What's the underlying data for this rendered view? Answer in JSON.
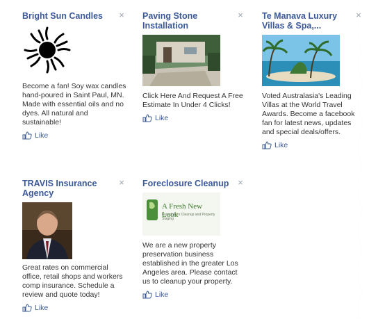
{
  "ads": [
    {
      "title": "Bright Sun Candles",
      "close": "×",
      "body": "Become a fan! Soy wax candles hand-poured in Saint Paul, MN. Made with essential oils and no dyes. All natural and sustainable!",
      "like": "Like",
      "image": "black-sun-icon"
    },
    {
      "title": "Paving Stone Installation",
      "close": "×",
      "body": "Click Here And Request A Free Estimate In Under 4 Clicks!",
      "like": "Like",
      "image": "paving-patio-photo"
    },
    {
      "title": "Te Manava Luxury Villas & Spa,...",
      "close": "×",
      "body": "Voted Australasia's Leading Villas at the World Travel Awards. Become a facebook fan for latest news, updates and special deals/offers.",
      "like": "Like",
      "image": "tropical-beach-photo"
    },
    {
      "title": "TRAVIS Insurance Agency",
      "close": "×",
      "body": "Great rates on commercial office, retail shops and workers comp insurance. Schedule a review and quote today!",
      "like": "Like",
      "image": "agent-portrait-photo"
    },
    {
      "title": "Foreclosure Cleanup",
      "close": "×",
      "body": "We are a new property preservation business established in the greater Los Angeles area. Please contact us to cleanup your property.",
      "like": "Like",
      "image": "a-fresh-new-look-logo",
      "logo_text": "A Fresh New Look",
      "logo_sub": "Foreclosure Cleanup and Property Staging"
    }
  ],
  "colors": {
    "link": "#3b5998",
    "text": "#333333",
    "close": "#9aa3ad"
  }
}
